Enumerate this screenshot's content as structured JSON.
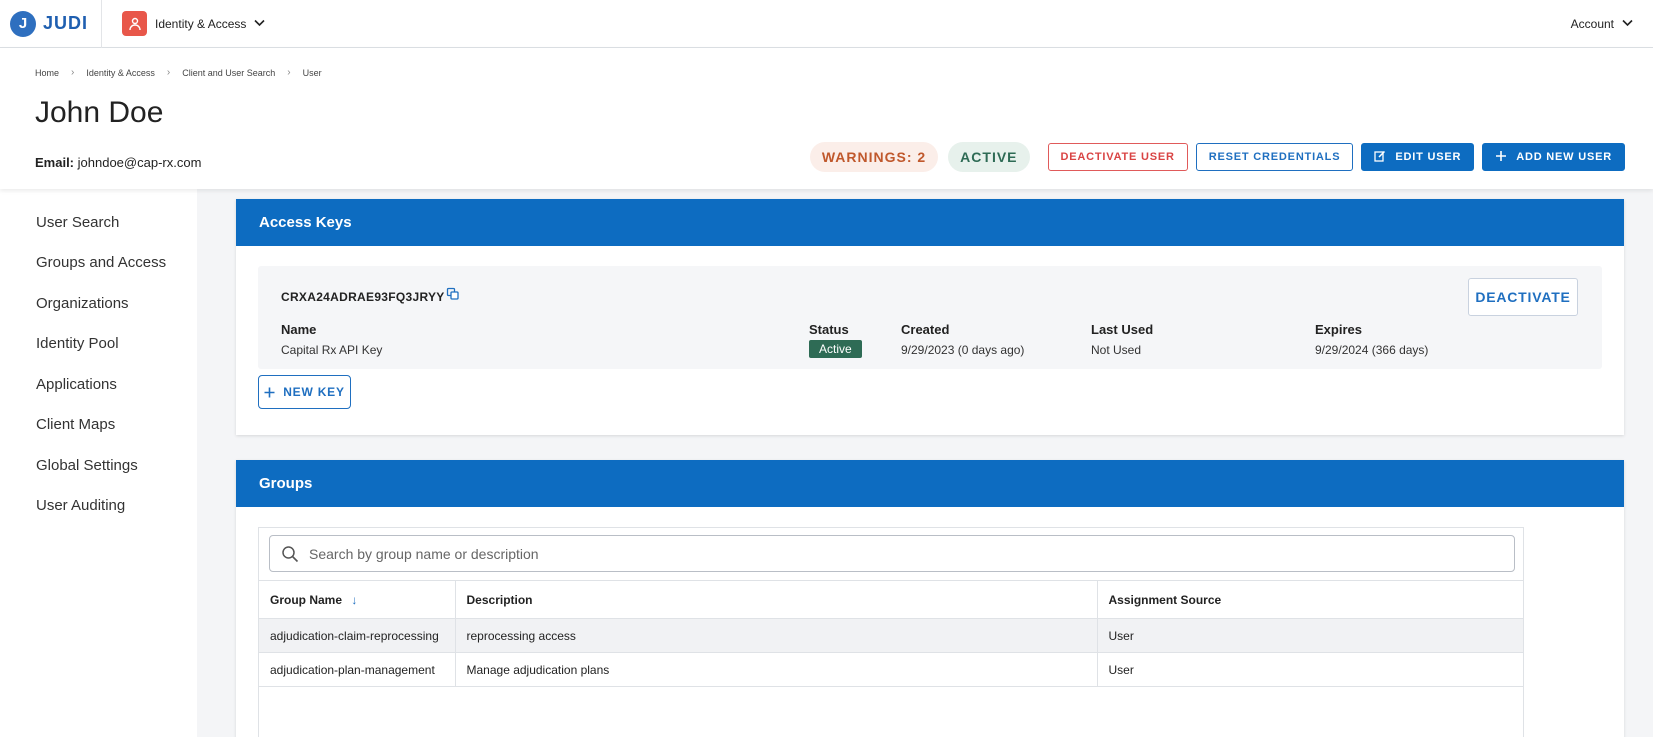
{
  "brand": {
    "name": "JUDI",
    "logo_glyph": "J"
  },
  "app_switcher": {
    "label": "Identity & Access",
    "icon": "identity-icon"
  },
  "account": {
    "label": "Account"
  },
  "breadcrumb": [
    "Home",
    "Identity & Access",
    "Client and User Search",
    "User"
  ],
  "user": {
    "name": "John Doe",
    "email_label": "Email:",
    "email": "johndoe@cap-rx.com"
  },
  "status_pills": {
    "warnings": "WARNINGS: 2",
    "active": "ACTIVE"
  },
  "actions": {
    "deactivate_user": "DEACTIVATE USER",
    "reset_credentials": "RESET CREDENTIALS",
    "edit_user": "EDIT USER",
    "add_new_user": "ADD NEW USER"
  },
  "sidebar": {
    "items": [
      {
        "label": "User Search"
      },
      {
        "label": "Groups and Access"
      },
      {
        "label": "Organizations"
      },
      {
        "label": "Identity Pool"
      },
      {
        "label": "Applications"
      },
      {
        "label": "Client Maps"
      },
      {
        "label": "Global Settings"
      },
      {
        "label": "User Auditing"
      }
    ]
  },
  "access_keys": {
    "title": "Access Keys",
    "key": {
      "id": "CRXA24ADRAE93FQ3JRYY",
      "name_label": "Name",
      "name": "Capital Rx API Key",
      "status_label": "Status",
      "status": "Active",
      "created_label": "Created",
      "created": "9/29/2023 (0 days ago)",
      "last_used_label": "Last Used",
      "last_used": "Not Used",
      "expires_label": "Expires",
      "expires": "9/29/2024 (366 days)"
    },
    "deactivate_label": "DEACTIVATE",
    "new_key_label": "NEW KEY"
  },
  "groups": {
    "title": "Groups",
    "search_placeholder": "Search by group name or description",
    "columns": [
      "Group Name",
      "Description",
      "Assignment Source"
    ],
    "rows": [
      {
        "name": "adjudication-claim-reprocessing",
        "description": "reprocessing access",
        "source": "User"
      },
      {
        "name": "adjudication-plan-management",
        "description": "Manage adjudication plans",
        "source": "User"
      }
    ]
  },
  "colors": {
    "primary": "#0d6cc1",
    "danger": "#d94444",
    "active_badge": "#2e6b55",
    "warning_text": "#c0582c"
  }
}
